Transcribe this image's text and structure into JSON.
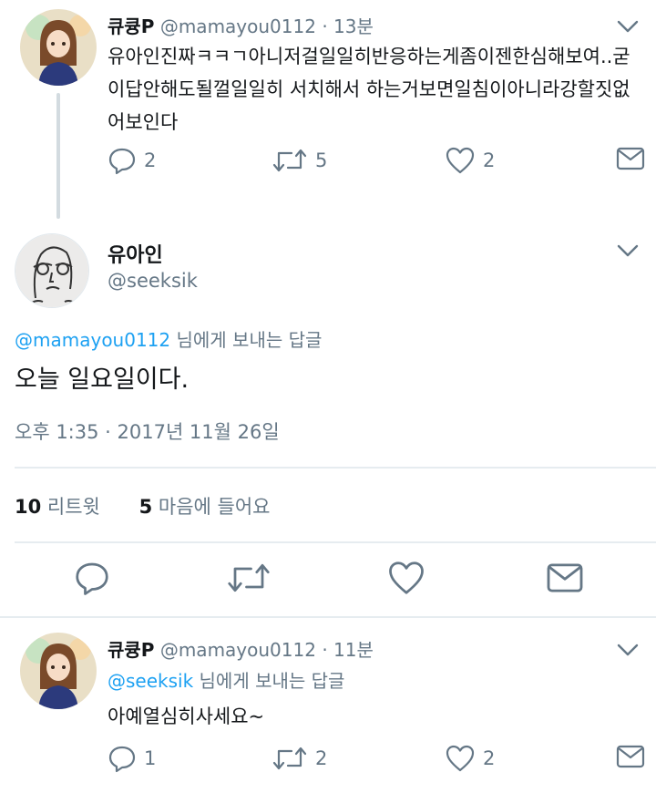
{
  "tweet1": {
    "name": "큐큥P",
    "handle": "@mamayou0112",
    "dot": "·",
    "time": "13분",
    "text": "유아인진짜ㅋㅋㄱ아니저걸일일히반응하는게좀이젠한심해보여..굳이답안해도될껄일일히 서치해서 하는거보면일침이아니라강할짓없어보인다",
    "replies": "2",
    "retweets": "5",
    "likes": "2"
  },
  "focus": {
    "name": "유아인",
    "handle": "@seeksik",
    "reply_mention": "@mamayou0112",
    "reply_suffix": " 님에게 보내는 답글",
    "text": "오늘 일요일이다.",
    "timestamp": "오후 1:35 · 2017년 11월 26일",
    "retweet_count": "10",
    "retweet_label": "리트윗",
    "like_count": "5",
    "like_label": "마음에 들어요"
  },
  "tweet2": {
    "name": "큐큥P",
    "handle": "@mamayou0112",
    "dot": "·",
    "time": "11분",
    "reply_mention": "@seeksik",
    "reply_suffix": " 님에게 보내는 답글",
    "text": "아예열심히사세요~",
    "replies": "1",
    "retweets": "2",
    "likes": "2"
  },
  "colors": {
    "accent": "#1da1f2",
    "secondary_text": "#657786",
    "divider": "#e6ecf0"
  }
}
